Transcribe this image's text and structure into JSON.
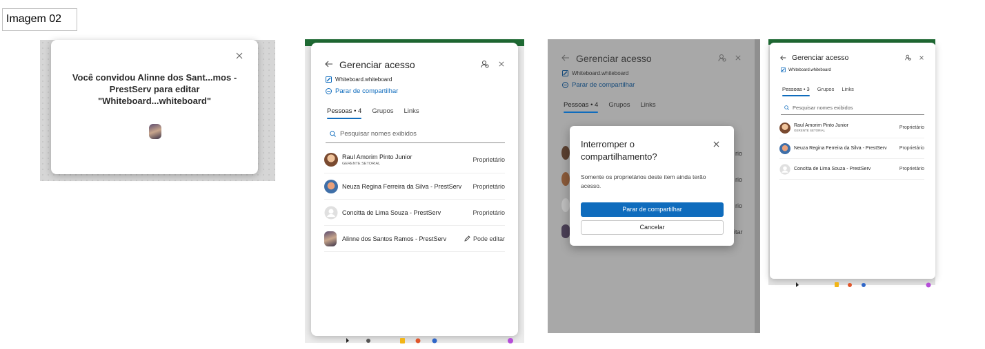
{
  "caption": "Imagem 02",
  "invite": {
    "message": "Você convidou Alinne dos Sant...mos - PrestServ para editar \"Whiteboard...whiteboard\""
  },
  "manage": {
    "title": "Gerenciar acesso",
    "file": "Whiteboard.whiteboard",
    "stop_sharing": "Parar de compartilhar",
    "tabs": [
      "Pessoas • 4",
      "Grupos",
      "Links"
    ],
    "search_placeholder": "Pesquisar nomes exibidos",
    "people": [
      {
        "name": "Raul Amorim Pinto Junior",
        "subtitle": "GERENTE SETORIAL",
        "role": "Proprietário"
      },
      {
        "name": "Neuza Regina Ferreira da Silva - PrestServ",
        "subtitle": "",
        "role": "Proprietário"
      },
      {
        "name": "Concitta de Lima Souza - PrestServ",
        "subtitle": "",
        "role": "Proprietário"
      },
      {
        "name": "Alinne dos Santos Ramos - PrestServ",
        "subtitle": "",
        "role": "Pode editar"
      }
    ]
  },
  "dialog": {
    "title": "Interromper o compartilhamento?",
    "body": "Somente os proprietários deste item ainda terão acesso.",
    "primary": "Parar de compartilhar",
    "secondary": "Cancelar",
    "bg_roles": [
      "rio",
      "rio",
      "rio",
      "itar"
    ]
  },
  "manage_after": {
    "title": "Gerenciar acesso",
    "file": "Whiteboard.whiteboard",
    "tabs": [
      "Pessoas • 3",
      "Grupos",
      "Links"
    ],
    "search_placeholder": "Pesquisar nomes exibidos",
    "people": [
      {
        "name": "Raul Amorim Pinto Junior",
        "subtitle": "GERENTE SETORIAL",
        "role": "Proprietário"
      },
      {
        "name": "Neuza Regina Ferreira da Silva - PrestServ",
        "subtitle": "",
        "role": "Proprietário"
      },
      {
        "name": "Concitta de Lima Souza - PrestServ",
        "subtitle": "",
        "role": "Proprietário"
      }
    ]
  },
  "colors": {
    "accent": "#0f6cbd",
    "app_bar": "#1f6b34"
  }
}
